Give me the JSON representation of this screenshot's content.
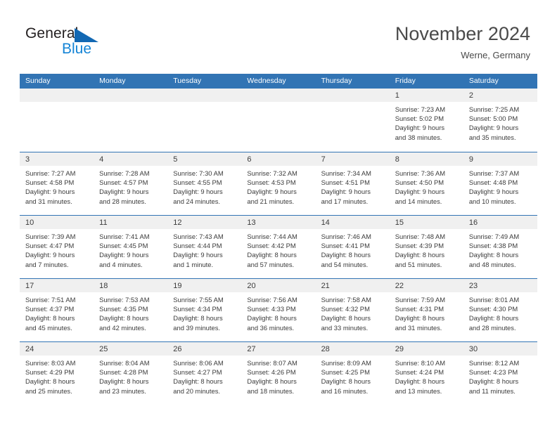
{
  "brand": {
    "name_part1": "General",
    "name_part2": "Blue",
    "triangle_color": "#1268b3",
    "blue_color": "#1484d6"
  },
  "header": {
    "title": "November 2024",
    "subtitle": "Werne, Germany"
  },
  "theme": {
    "header_row_bg": "#3274b4",
    "day_band_bg": "#f0f0f0",
    "text_color": "#3b3b3b"
  },
  "weekday_headers": [
    "Sunday",
    "Monday",
    "Tuesday",
    "Wednesday",
    "Thursday",
    "Friday",
    "Saturday"
  ],
  "weeks": [
    [
      {
        "day": "",
        "sunrise": "",
        "sunset": "",
        "daylight_line1": "",
        "daylight_line2": ""
      },
      {
        "day": "",
        "sunrise": "",
        "sunset": "",
        "daylight_line1": "",
        "daylight_line2": ""
      },
      {
        "day": "",
        "sunrise": "",
        "sunset": "",
        "daylight_line1": "",
        "daylight_line2": ""
      },
      {
        "day": "",
        "sunrise": "",
        "sunset": "",
        "daylight_line1": "",
        "daylight_line2": ""
      },
      {
        "day": "",
        "sunrise": "",
        "sunset": "",
        "daylight_line1": "",
        "daylight_line2": ""
      },
      {
        "day": "1",
        "sunrise": "Sunrise: 7:23 AM",
        "sunset": "Sunset: 5:02 PM",
        "daylight_line1": "Daylight: 9 hours",
        "daylight_line2": "and 38 minutes."
      },
      {
        "day": "2",
        "sunrise": "Sunrise: 7:25 AM",
        "sunset": "Sunset: 5:00 PM",
        "daylight_line1": "Daylight: 9 hours",
        "daylight_line2": "and 35 minutes."
      }
    ],
    [
      {
        "day": "3",
        "sunrise": "Sunrise: 7:27 AM",
        "sunset": "Sunset: 4:58 PM",
        "daylight_line1": "Daylight: 9 hours",
        "daylight_line2": "and 31 minutes."
      },
      {
        "day": "4",
        "sunrise": "Sunrise: 7:28 AM",
        "sunset": "Sunset: 4:57 PM",
        "daylight_line1": "Daylight: 9 hours",
        "daylight_line2": "and 28 minutes."
      },
      {
        "day": "5",
        "sunrise": "Sunrise: 7:30 AM",
        "sunset": "Sunset: 4:55 PM",
        "daylight_line1": "Daylight: 9 hours",
        "daylight_line2": "and 24 minutes."
      },
      {
        "day": "6",
        "sunrise": "Sunrise: 7:32 AM",
        "sunset": "Sunset: 4:53 PM",
        "daylight_line1": "Daylight: 9 hours",
        "daylight_line2": "and 21 minutes."
      },
      {
        "day": "7",
        "sunrise": "Sunrise: 7:34 AM",
        "sunset": "Sunset: 4:51 PM",
        "daylight_line1": "Daylight: 9 hours",
        "daylight_line2": "and 17 minutes."
      },
      {
        "day": "8",
        "sunrise": "Sunrise: 7:36 AM",
        "sunset": "Sunset: 4:50 PM",
        "daylight_line1": "Daylight: 9 hours",
        "daylight_line2": "and 14 minutes."
      },
      {
        "day": "9",
        "sunrise": "Sunrise: 7:37 AM",
        "sunset": "Sunset: 4:48 PM",
        "daylight_line1": "Daylight: 9 hours",
        "daylight_line2": "and 10 minutes."
      }
    ],
    [
      {
        "day": "10",
        "sunrise": "Sunrise: 7:39 AM",
        "sunset": "Sunset: 4:47 PM",
        "daylight_line1": "Daylight: 9 hours",
        "daylight_line2": "and 7 minutes."
      },
      {
        "day": "11",
        "sunrise": "Sunrise: 7:41 AM",
        "sunset": "Sunset: 4:45 PM",
        "daylight_line1": "Daylight: 9 hours",
        "daylight_line2": "and 4 minutes."
      },
      {
        "day": "12",
        "sunrise": "Sunrise: 7:43 AM",
        "sunset": "Sunset: 4:44 PM",
        "daylight_line1": "Daylight: 9 hours",
        "daylight_line2": "and 1 minute."
      },
      {
        "day": "13",
        "sunrise": "Sunrise: 7:44 AM",
        "sunset": "Sunset: 4:42 PM",
        "daylight_line1": "Daylight: 8 hours",
        "daylight_line2": "and 57 minutes."
      },
      {
        "day": "14",
        "sunrise": "Sunrise: 7:46 AM",
        "sunset": "Sunset: 4:41 PM",
        "daylight_line1": "Daylight: 8 hours",
        "daylight_line2": "and 54 minutes."
      },
      {
        "day": "15",
        "sunrise": "Sunrise: 7:48 AM",
        "sunset": "Sunset: 4:39 PM",
        "daylight_line1": "Daylight: 8 hours",
        "daylight_line2": "and 51 minutes."
      },
      {
        "day": "16",
        "sunrise": "Sunrise: 7:49 AM",
        "sunset": "Sunset: 4:38 PM",
        "daylight_line1": "Daylight: 8 hours",
        "daylight_line2": "and 48 minutes."
      }
    ],
    [
      {
        "day": "17",
        "sunrise": "Sunrise: 7:51 AM",
        "sunset": "Sunset: 4:37 PM",
        "daylight_line1": "Daylight: 8 hours",
        "daylight_line2": "and 45 minutes."
      },
      {
        "day": "18",
        "sunrise": "Sunrise: 7:53 AM",
        "sunset": "Sunset: 4:35 PM",
        "daylight_line1": "Daylight: 8 hours",
        "daylight_line2": "and 42 minutes."
      },
      {
        "day": "19",
        "sunrise": "Sunrise: 7:55 AM",
        "sunset": "Sunset: 4:34 PM",
        "daylight_line1": "Daylight: 8 hours",
        "daylight_line2": "and 39 minutes."
      },
      {
        "day": "20",
        "sunrise": "Sunrise: 7:56 AM",
        "sunset": "Sunset: 4:33 PM",
        "daylight_line1": "Daylight: 8 hours",
        "daylight_line2": "and 36 minutes."
      },
      {
        "day": "21",
        "sunrise": "Sunrise: 7:58 AM",
        "sunset": "Sunset: 4:32 PM",
        "daylight_line1": "Daylight: 8 hours",
        "daylight_line2": "and 33 minutes."
      },
      {
        "day": "22",
        "sunrise": "Sunrise: 7:59 AM",
        "sunset": "Sunset: 4:31 PM",
        "daylight_line1": "Daylight: 8 hours",
        "daylight_line2": "and 31 minutes."
      },
      {
        "day": "23",
        "sunrise": "Sunrise: 8:01 AM",
        "sunset": "Sunset: 4:30 PM",
        "daylight_line1": "Daylight: 8 hours",
        "daylight_line2": "and 28 minutes."
      }
    ],
    [
      {
        "day": "24",
        "sunrise": "Sunrise: 8:03 AM",
        "sunset": "Sunset: 4:29 PM",
        "daylight_line1": "Daylight: 8 hours",
        "daylight_line2": "and 25 minutes."
      },
      {
        "day": "25",
        "sunrise": "Sunrise: 8:04 AM",
        "sunset": "Sunset: 4:28 PM",
        "daylight_line1": "Daylight: 8 hours",
        "daylight_line2": "and 23 minutes."
      },
      {
        "day": "26",
        "sunrise": "Sunrise: 8:06 AM",
        "sunset": "Sunset: 4:27 PM",
        "daylight_line1": "Daylight: 8 hours",
        "daylight_line2": "and 20 minutes."
      },
      {
        "day": "27",
        "sunrise": "Sunrise: 8:07 AM",
        "sunset": "Sunset: 4:26 PM",
        "daylight_line1": "Daylight: 8 hours",
        "daylight_line2": "and 18 minutes."
      },
      {
        "day": "28",
        "sunrise": "Sunrise: 8:09 AM",
        "sunset": "Sunset: 4:25 PM",
        "daylight_line1": "Daylight: 8 hours",
        "daylight_line2": "and 16 minutes."
      },
      {
        "day": "29",
        "sunrise": "Sunrise: 8:10 AM",
        "sunset": "Sunset: 4:24 PM",
        "daylight_line1": "Daylight: 8 hours",
        "daylight_line2": "and 13 minutes."
      },
      {
        "day": "30",
        "sunrise": "Sunrise: 8:12 AM",
        "sunset": "Sunset: 4:23 PM",
        "daylight_line1": "Daylight: 8 hours",
        "daylight_line2": "and 11 minutes."
      }
    ]
  ]
}
